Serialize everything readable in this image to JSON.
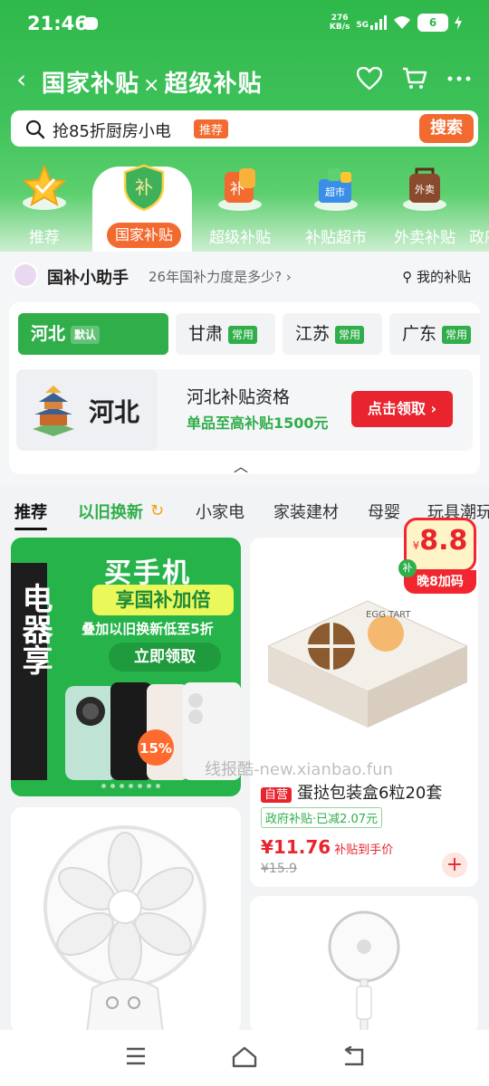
{
  "status": {
    "time": "21:46",
    "net_speed_top": "276",
    "net_speed_bottom": "KB/s",
    "network": "5G",
    "battery": "6"
  },
  "header": {
    "title_left": "国家补贴",
    "title_sep": "×",
    "title_right": "超级补贴"
  },
  "search": {
    "query": "抢85折厨房小电",
    "tag": "推荐",
    "button": "搜索"
  },
  "categories": [
    {
      "label": "推荐"
    },
    {
      "label": "国家补贴"
    },
    {
      "label": "超级补贴"
    },
    {
      "label": "补贴超市"
    },
    {
      "label": "外卖补贴"
    },
    {
      "label": "政府"
    }
  ],
  "helper": {
    "title": "国补小助手",
    "question": "26年国补力度是多少?",
    "my_subsidy": "我的补贴"
  },
  "provinces": [
    {
      "name": "河北",
      "tag": "默认"
    },
    {
      "name": "甘肃",
      "tag": "常用"
    },
    {
      "name": "江苏",
      "tag": "常用"
    },
    {
      "name": "广东",
      "tag": "常用"
    }
  ],
  "qualification": {
    "province": "河北",
    "title": "河北补贴资格",
    "subtitle": "单品至高补贴1500元",
    "button": "点击领取"
  },
  "tabs": [
    "推荐",
    "以旧换新",
    "小家电",
    "家装建材",
    "母婴",
    "玩具潮玩"
  ],
  "banner": {
    "title": "买手机",
    "pill": "享国补加倍",
    "sub": "叠加以旧换新低至5折",
    "button": "立即领取",
    "side_text": "电器享",
    "discount": "15%"
  },
  "watermark": "线报酷-new.xianbao.fun",
  "product": {
    "self_tag": "自营",
    "name": "蛋挞包装盒6粒20套",
    "badge": "政府补贴·已减2.07元",
    "price": "¥11.76",
    "price_note": "补贴到手价",
    "old_price": "¥15.9",
    "box_text": "EGG TART"
  },
  "badge88": {
    "currency": "¥",
    "value": "8.8",
    "label": "晚8加码",
    "bu": "补"
  },
  "colors": {
    "brand_green": "#2fae4a",
    "accent_orange": "#f26a2f",
    "red": "#e8242e"
  }
}
